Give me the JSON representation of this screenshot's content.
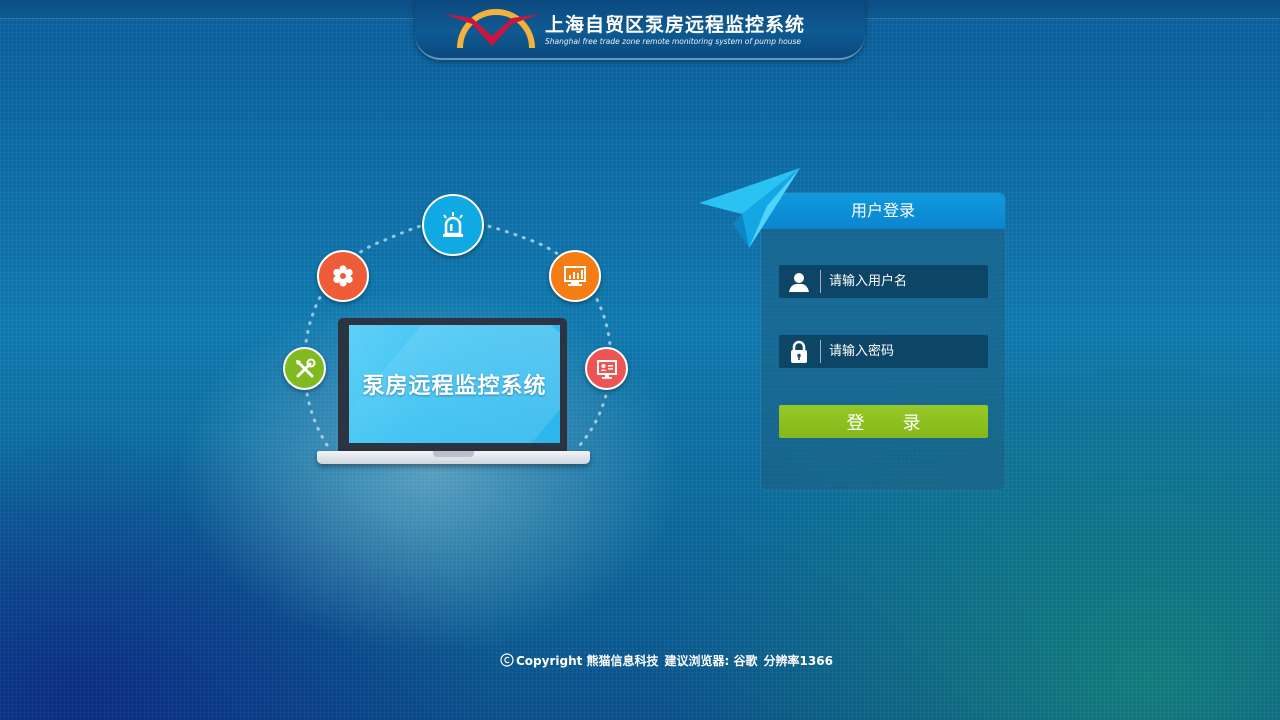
{
  "header": {
    "title": "上海自贸区泵房远程监控系统",
    "subtitle": "Shanghai free trade zone remote monitoring system of pump house"
  },
  "illustration": {
    "screen_text": "泵房远程监控系统",
    "icons": [
      "alarm-light-icon",
      "gear-icon",
      "chart-monitor-icon",
      "tools-icon",
      "id-card-icon"
    ],
    "colors": {
      "alarm": "#10a9e4",
      "gear": "#ef5d38",
      "chart": "#f57d14",
      "tools": "#7fba1f",
      "idcard": "#ef5454"
    }
  },
  "login": {
    "title": "用户登录",
    "username_placeholder": "请输入用户名",
    "password_placeholder": "请输入密码",
    "submit_label": "登录",
    "accent_color": "#0f99dd",
    "button_color": "#8cbf21"
  },
  "footer": {
    "copyright": "Copyright 熊猫信息科技",
    "browser": "建议浏览器: 谷歌",
    "resolution": "分辨率1366"
  }
}
